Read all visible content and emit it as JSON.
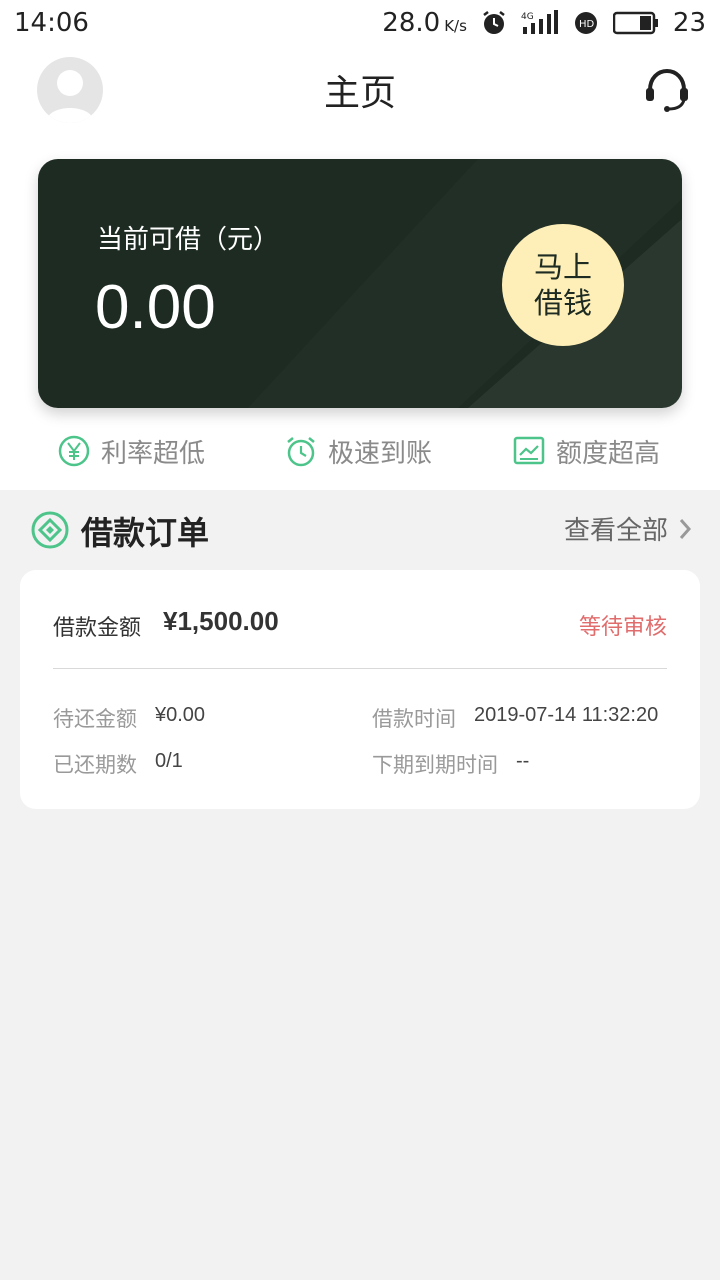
{
  "status_bar": {
    "time": "14:06",
    "speed": "28.0",
    "speed_unit": "K/s",
    "battery": "23"
  },
  "header": {
    "title": "主页"
  },
  "hero": {
    "label": "当前可借（元）",
    "amount": "0.00",
    "button_line1": "马上",
    "button_line2": "借钱",
    "accent_color": "#1d2b22",
    "button_color": "#fdefb7"
  },
  "features": [
    {
      "icon": "yen-icon",
      "label": "利率超低"
    },
    {
      "icon": "alarm-clock-icon",
      "label": "极速到账"
    },
    {
      "icon": "chart-icon",
      "label": "额度超高"
    }
  ],
  "orders_section": {
    "title": "借款订单",
    "view_all": "查看全部"
  },
  "order": {
    "amount_label": "借款金额",
    "amount_value": "¥1,500.00",
    "status": "等待审核",
    "pending_label": "待还金额",
    "pending_value": "¥0.00",
    "time_label": "借款时间",
    "time_value": "2019-07-14 11:32:20",
    "periods_label": "已还期数",
    "periods_value": "0/1",
    "next_due_label": "下期到期时间",
    "next_due_value": "--"
  },
  "colors": {
    "green": "#4cc48a",
    "status_red": "#e06c6c"
  }
}
